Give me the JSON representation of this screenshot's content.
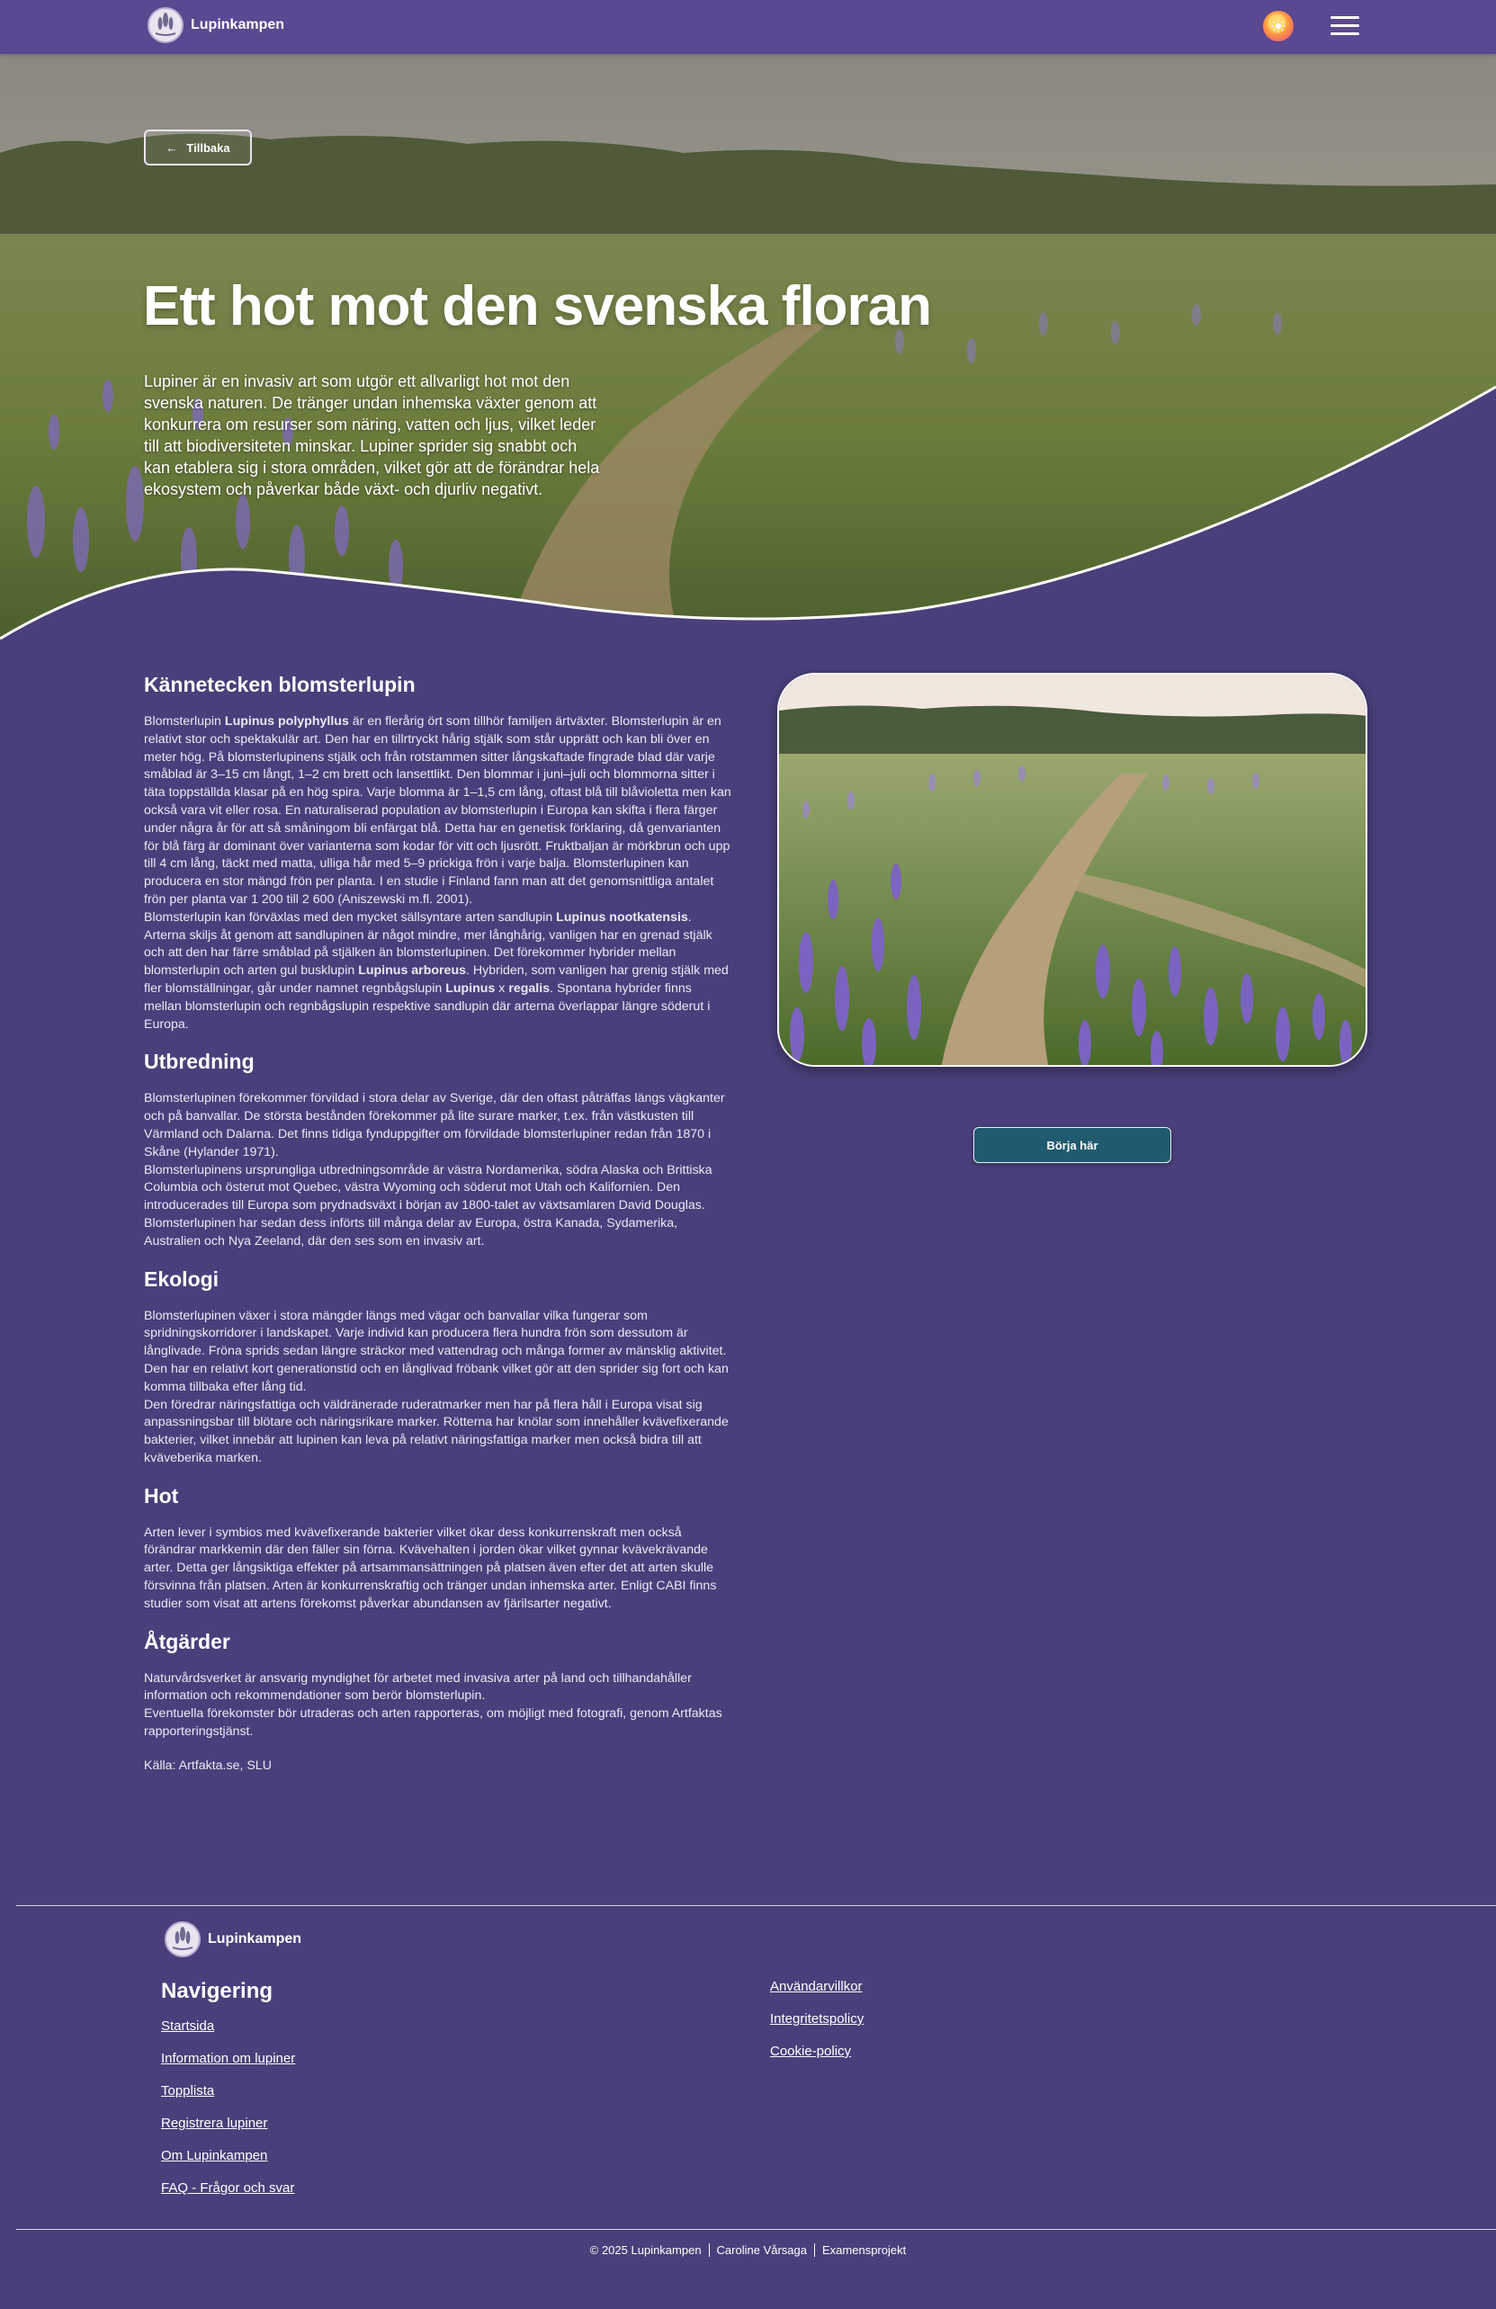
{
  "header": {
    "brand": "Lupinkampen",
    "theme_icon": "sun-icon",
    "menu_icon": "hamburger-icon"
  },
  "hero": {
    "back_label": "Tillbaka",
    "title": "Ett hot mot den svenska floran",
    "text": "Lupiner är en invasiv art som utgör ett allvarligt hot mot den svenska naturen. De tränger undan inhemska växter genom att konkurrera om resurser som näring, vatten och ljus, vilket leder till att biodiversiteten minskar. Lupiner sprider sig snabbt och kan etablera sig i stora områden, vilket gör att de förändrar hela ekosystem och påverkar både växt- och djurliv negativt."
  },
  "sections": {
    "kannetecken": {
      "title": "Kännetecken blomsterlupin",
      "p1_a": "Blomsterlupin ",
      "p1_b": "Lupinus polyphyllus",
      "p1_c": " är en flerårig ört som tillhör familjen ärtväxter. Blomsterlupin är en relativt stor och spektakulär art. Den har en tillrtryckt hårig stjälk som står upprätt och kan bli över en meter hög. På blomsterlupinens stjälk och från rotstammen sitter långskaftade fingrade blad där varje småblad är 3–15 cm långt, 1–2 cm brett och lansettlikt. Den blommar i juni–juli och blommorna sitter i täta toppställda klasar på en hög spira. Varje blomma är 1–1,5 cm lång, oftast blå till blåvioletta men kan också vara vit eller rosa. En naturaliserad population av blomsterlupin i Europa kan skifta i flera färger under några år för att så småningom bli enfärgat blå. Detta har en genetisk förklaring, då genvarianten för blå färg är dominant över varianterna som kodar för vitt och ljusrött. Fruktbaljan är mörkbrun och upp till 4 cm lång, täckt med matta, ulliga hår med 5–9 prickiga frön i varje balja. Blomsterlupinen kan producera en stor mängd frön per planta. I en studie i Finland fann man att det genomsnittliga antalet frön per planta var 1 200 till 2 600 (Aniszewski m.fl. 2001).",
      "p2_a": "Blomsterlupin kan förväxlas med den mycket sällsyntare arten sandlupin ",
      "p2_b": "Lupinus nootkatensis",
      "p2_c": ". Arterna skiljs åt genom att sandlupinen är något mindre, mer långhårig, vanligen har en grenad stjälk och att den har färre småblad på stjälken än blomsterlupinen. Det förekommer hybrider mellan blomsterlupin och arten gul busklupin ",
      "p2_d": "Lupinus arboreus",
      "p2_e": ". Hybriden, som vanligen har grenig stjälk med fler blomställningar, går under namnet regnbågslupin ",
      "p2_f": "Lupinus",
      "p2_g": " x ",
      "p2_h": "regalis",
      "p2_i": ". Spontana hybrider finns mellan blomsterlupin och regnbågslupin respektive sandlupin där arterna överlappar längre söderut i Europa."
    },
    "utbredning": {
      "title": "Utbredning",
      "p1": "Blomsterlupinen förekommer förvildad i stora delar av Sverige, där den oftast påträffas längs vägkanter och på banvallar. De största bestånden förekommer på lite surare marker, t.ex. från västkusten till Värmland och Dalarna. Det finns tidiga fynduppgifter om förvildade blomsterlupiner redan från 1870 i Skåne (Hylander 1971).",
      "p2": "Blomsterlupinens ursprungliga utbredningsområde är västra Nordamerika, södra Alaska och Brittiska Columbia och österut mot Quebec, västra Wyoming och söderut mot Utah och Kalifornien. Den introducerades till Europa som prydnadsväxt i början av 1800-talet av växtsamlaren David Douglas. Blomsterlupinen har sedan dess införts till många delar av Europa, östra Kanada, Sydamerika, Australien och Nya Zeeland, där den ses som en invasiv art."
    },
    "ekologi": {
      "title": "Ekologi",
      "p1": "Blomsterlupinen växer i stora mängder längs med vägar och banvallar vilka fungerar som spridningskorridorer i landskapet. Varje individ kan producera flera hundra frön som dessutom är långlivade. Fröna sprids sedan längre sträckor med vattendrag och många former av mänsklig aktivitet. Den har en relativt kort generationstid och en långlivad fröbank vilket gör att den sprider sig fort och kan komma tillbaka efter lång tid.",
      "p2": "Den föredrar näringsfattiga och väldränerade ruderatmarker men har på flera håll i Europa visat sig anpassningsbar till blötare och näringsrikare marker. Rötterna har knölar som innehåller kvävefixerande bakterier, vilket innebär att lupinen kan leva på relativt näringsfattiga marker men också bidra till att kväveberika marken."
    },
    "hot": {
      "title": "Hot",
      "p1": "Arten lever i symbios med kvävefixerande bakterier vilket ökar dess konkurrenskraft men också förändrar markkemin där den fäller sin förna. Kvävehalten i jorden ökar vilket gynnar kvävekrävande arter. Detta ger långsiktiga effekter på artsammansättningen på platsen även efter det att arten skulle försvinna från platsen. Arten är konkurrenskraftig och tränger undan inhemska arter. Enligt CABI finns studier som visat att artens förekomst påverkar abundansen av fjärilsarter negativt."
    },
    "atgarder": {
      "title": "Åtgärder",
      "p1": "Naturvårdsverket är ansvarig myndighet för arbetet med invasiva arter på land och tillhandahåller information och rekommendationer som berör blomsterlupin.",
      "p2": "Eventuella förekomster bör utraderas och arten rapporteras, om möjligt med fotografi, genom Artfaktas rapporteringstjänst."
    },
    "source": "Källa: Artfakta.se, SLU"
  },
  "start_button": "Börja här",
  "footer": {
    "brand": "Lupinkampen",
    "nav_title": "Navigering",
    "nav_items": [
      "Startsida",
      "Information om lupiner",
      "Topplista",
      "Registrera lupiner",
      "Om Lupinkampen",
      "FAQ - Frågor och svar"
    ],
    "legal_items": [
      "Användarvillkor",
      "Integritetspolicy",
      "Cookie-policy"
    ],
    "copyright": "© 2025 Lupinkampen",
    "author": "Caroline Vårsaga",
    "project": "Examensprojekt"
  }
}
